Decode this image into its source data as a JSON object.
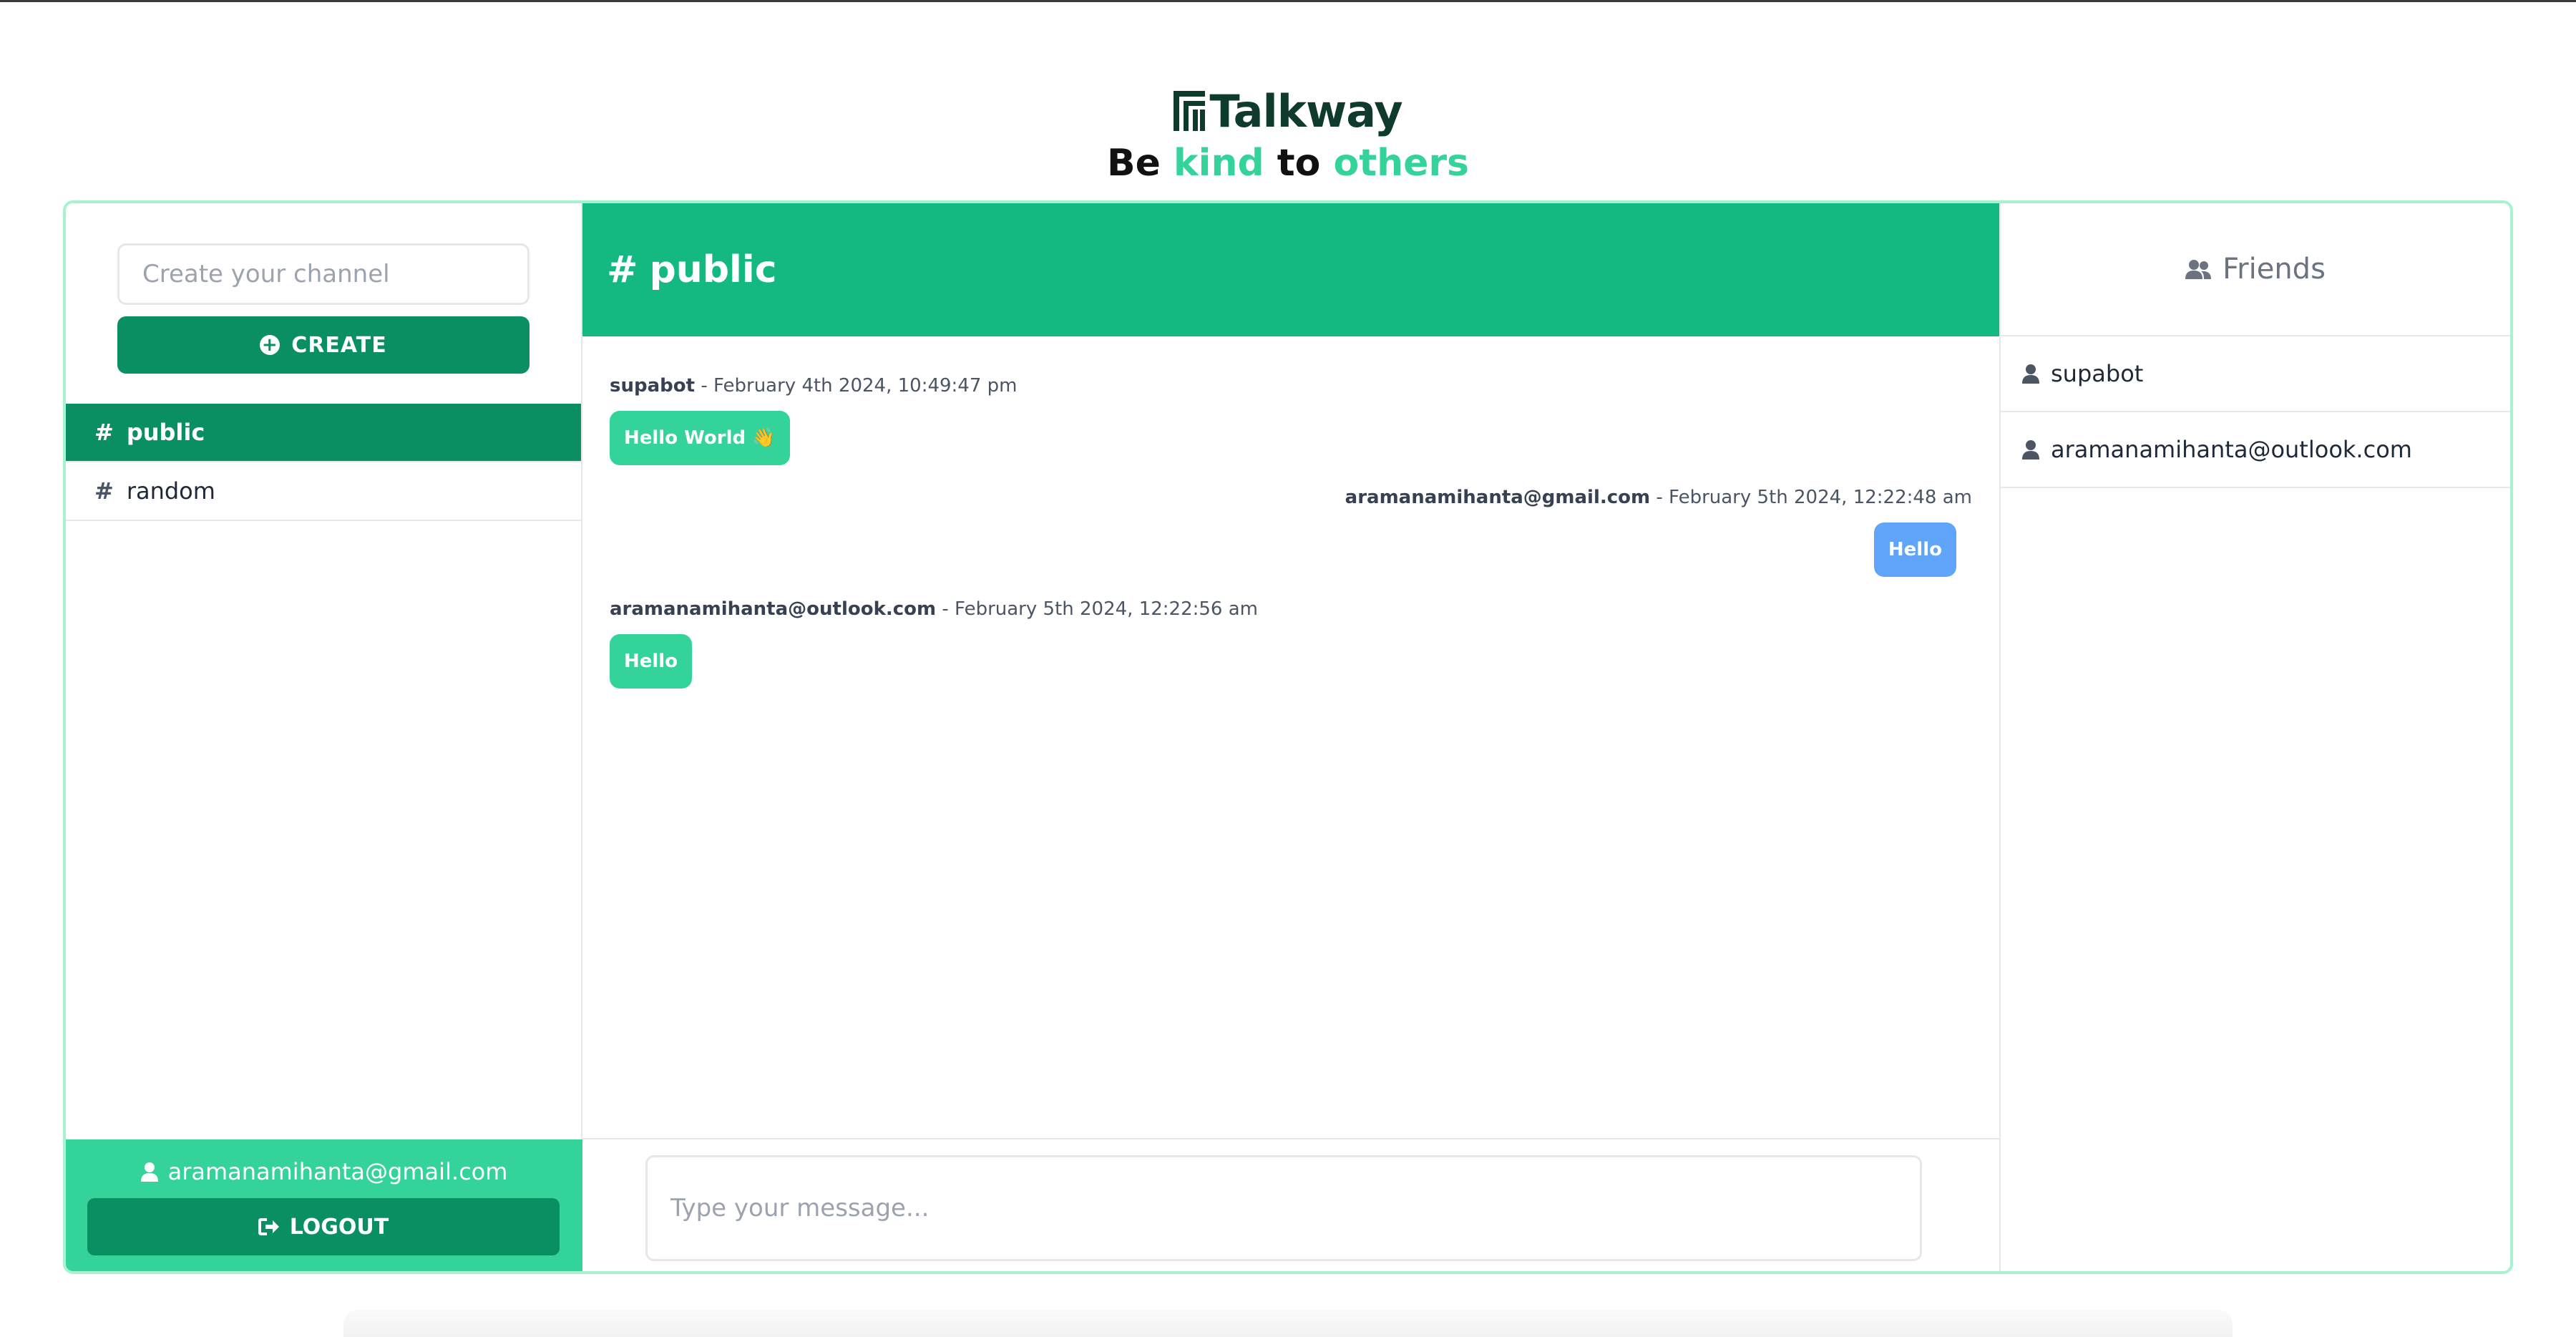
{
  "app": {
    "logo_text": "Talkway",
    "tagline": {
      "part1": "Be",
      "part2": "kind",
      "part3": "to",
      "part4": "others"
    }
  },
  "colors": {
    "brand_dark": "#0a8f63",
    "brand": "#14b981",
    "accent": "#34d399",
    "own_bubble": "#60a5fa",
    "border_accent": "#a7f3d0"
  },
  "sidebar": {
    "create_placeholder": "Create your channel",
    "create_label": "CREATE",
    "channels": [
      {
        "name": "public",
        "active": true
      },
      {
        "name": "random",
        "active": false
      }
    ],
    "current_user": "aramanamihanta@gmail.com",
    "logout_label": "LOGOUT"
  },
  "chat": {
    "channel_title": "public",
    "messages": [
      {
        "author": "supabot",
        "timestamp": "February 4th 2024, 10:49:47 pm",
        "text": "Hello World 👋",
        "own": false
      },
      {
        "author": "aramanamihanta@gmail.com",
        "timestamp": "February 5th 2024, 12:22:48 am",
        "text": "Hello",
        "own": true
      },
      {
        "author": "aramanamihanta@outlook.com",
        "timestamp": "February 5th 2024, 12:22:56 am",
        "text": "Hello",
        "own": false
      }
    ],
    "separator": "-",
    "compose_placeholder": "Type your message..."
  },
  "friends": {
    "title": "Friends",
    "list": [
      "supabot",
      "aramanamihanta@outlook.com"
    ]
  }
}
